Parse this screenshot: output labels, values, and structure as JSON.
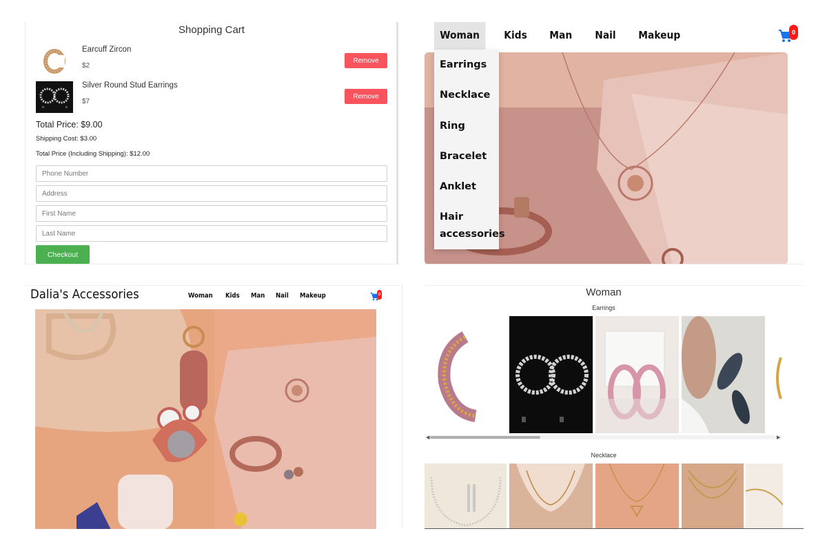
{
  "cart": {
    "title": "Shopping Cart",
    "items": [
      {
        "name": "Earcuff Zircon",
        "price": "$2",
        "remove_label": "Remove"
      },
      {
        "name": "Silver Round Stud Earrings",
        "price": "$7",
        "remove_label": "Remove"
      }
    ],
    "total_price": "Total Price: $9.00",
    "shipping_cost": "Shipping Cost: $3.00",
    "total_with_shipping": "Total Price (Including Shipping): $12.00",
    "fields": {
      "phone_placeholder": "Phone Number",
      "address_placeholder": "Address",
      "first_name_placeholder": "First Name",
      "last_name_placeholder": "Last Name"
    },
    "checkout_label": "Checkout"
  },
  "nav": {
    "items": [
      "Woman",
      "Kids",
      "Man",
      "Nail",
      "Makeup"
    ],
    "cart_count": "0"
  },
  "dropdown": {
    "items": [
      "Earrings",
      "Necklace",
      "Ring",
      "Bracelet",
      "Anklet",
      "Hair accessories"
    ]
  },
  "home": {
    "logo": "Dalia's Accessories",
    "nav_items": [
      "Woman",
      "Kids",
      "Man",
      "Nail",
      "Makeup"
    ],
    "cart_count": "0"
  },
  "category": {
    "title": "Woman",
    "sections": [
      "Earrings",
      "Necklace"
    ]
  },
  "colors": {
    "remove_button": "#f9535e",
    "checkout_button": "#4caf50",
    "cart_icon": "#1a73e8",
    "badge": "#ff1a1a"
  },
  "icons": [
    "shopping-cart-icon"
  ]
}
